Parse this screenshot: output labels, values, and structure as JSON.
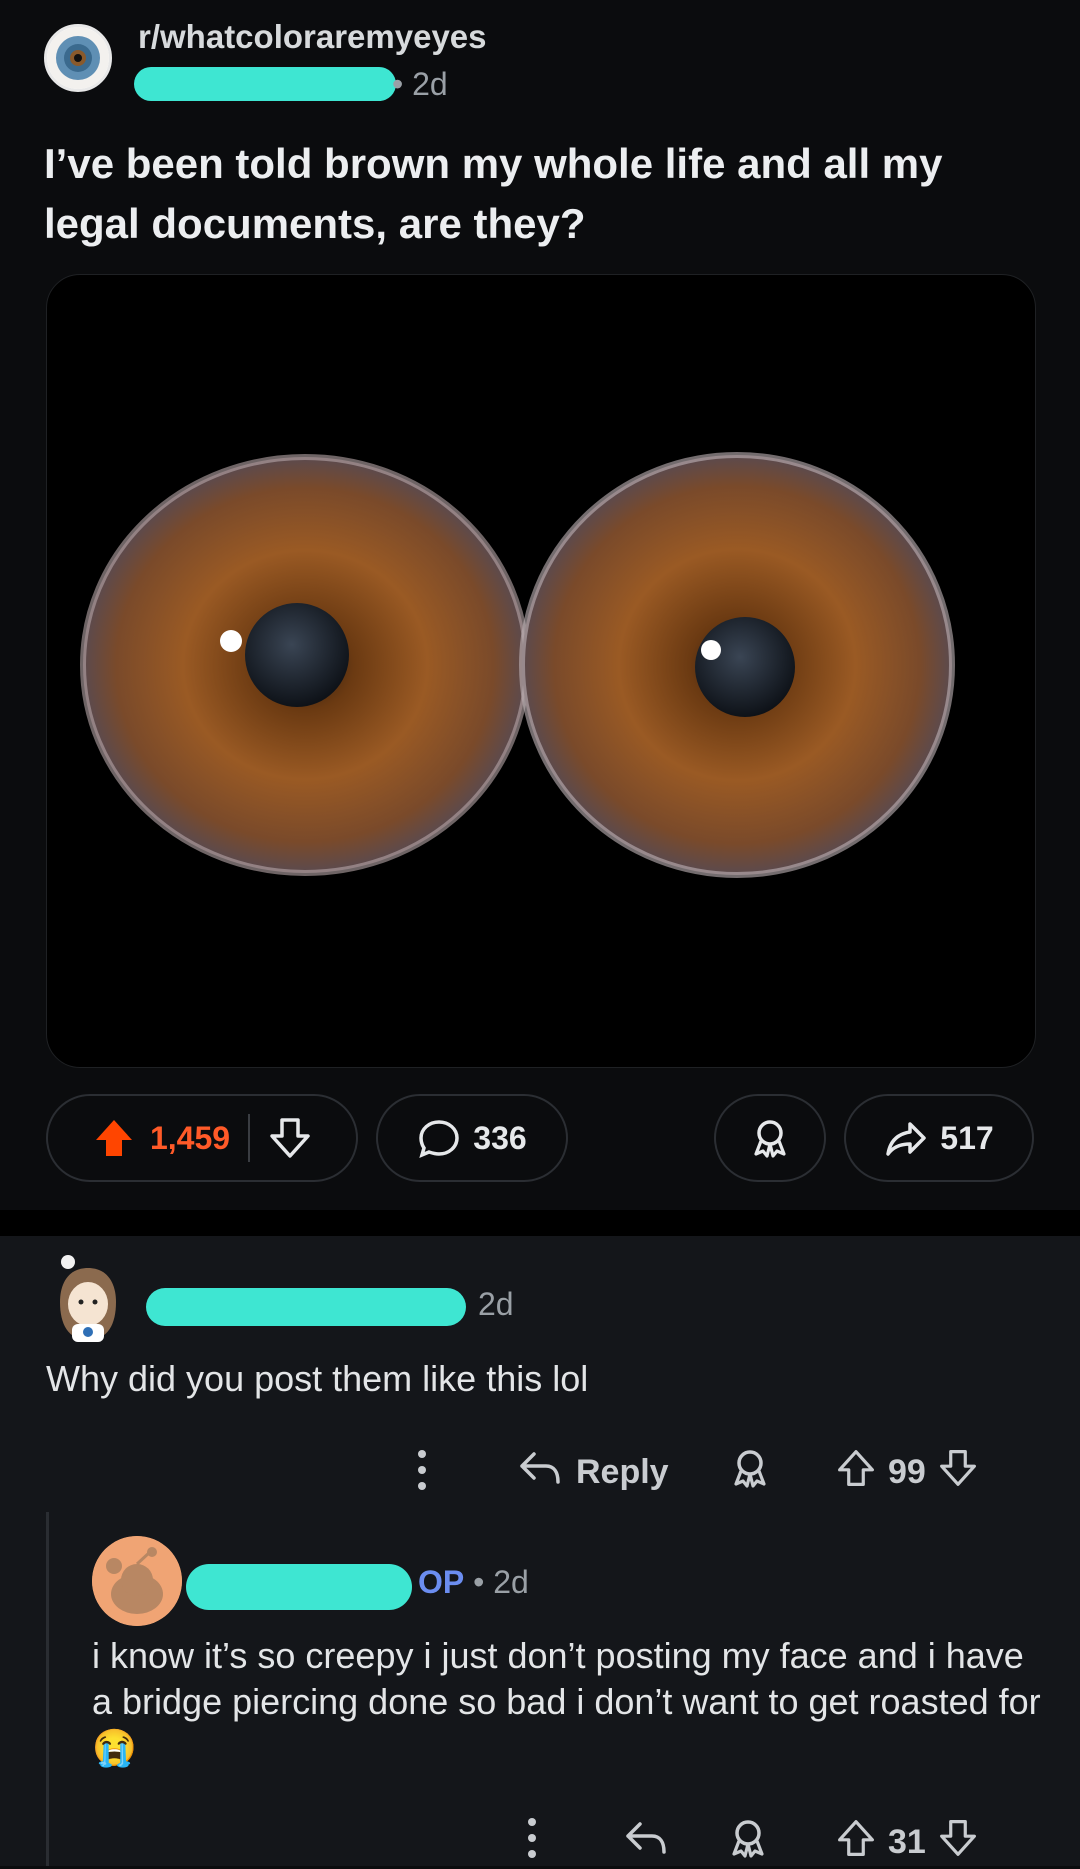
{
  "post": {
    "subreddit": "r/whatcoloraremyeyes",
    "time": "• 2d",
    "title": "I’ve been told brown my whole life and all my legal documents, are they?",
    "upvotes": "1,459",
    "comments": "336",
    "shares": "517"
  },
  "comments": [
    {
      "time": "2d",
      "text": "Why did you post them like this lol",
      "reply_label": "Reply",
      "score": "99"
    },
    {
      "op_label": "OP",
      "time": "• 2d",
      "text": "i know it’s so creepy i just don’t posting my face and i have a bridge piercing done so bad i don’t want to get roasted for",
      "emoji": "😭",
      "score": "31"
    }
  ],
  "colors": {
    "background": "#0b0c0e",
    "upvote_active": "#ff4500",
    "redaction": "#3ee6d2",
    "op_badge": "#6b8df0"
  }
}
